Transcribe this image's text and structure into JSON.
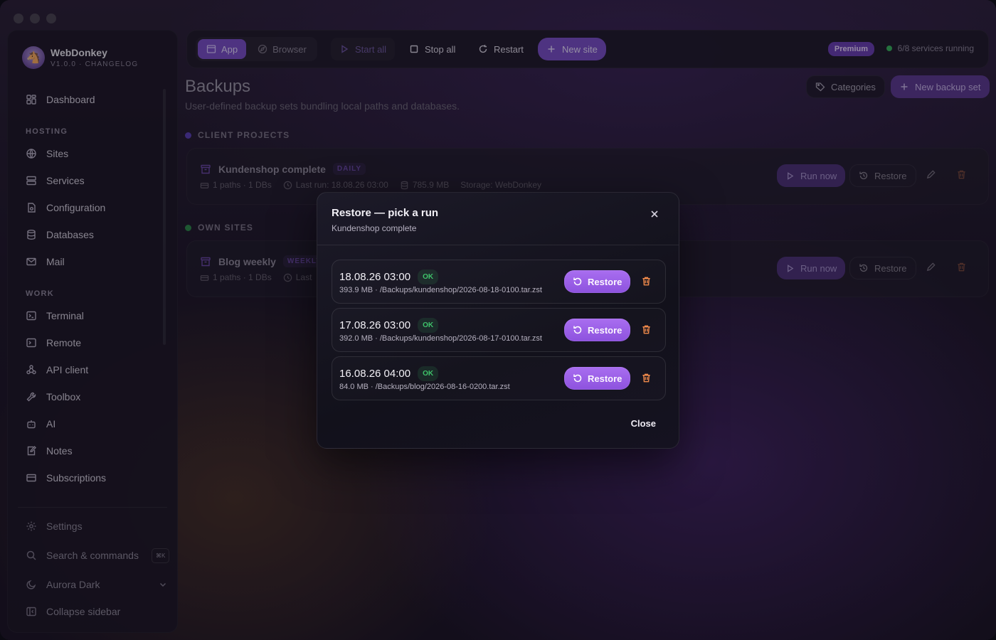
{
  "brand": {
    "name": "WebDonkey",
    "sub": "V1.0.0 · CHANGELOG"
  },
  "sidebar": {
    "top": [
      {
        "label": "Dashboard",
        "icon": "dashboard-icon"
      }
    ],
    "hosting_heading": "HOSTING",
    "hosting": [
      {
        "label": "Sites",
        "icon": "globe-icon"
      },
      {
        "label": "Services",
        "icon": "server-icon"
      },
      {
        "label": "Configuration",
        "icon": "config-file-icon"
      },
      {
        "label": "Databases",
        "icon": "database-icon"
      },
      {
        "label": "Mail",
        "icon": "mail-icon"
      }
    ],
    "work_heading": "WORK",
    "work": [
      {
        "label": "Terminal",
        "icon": "terminal-icon"
      },
      {
        "label": "Remote",
        "icon": "remote-terminal-icon"
      },
      {
        "label": "API client",
        "icon": "webhook-icon"
      },
      {
        "label": "Toolbox",
        "icon": "wrench-icon"
      },
      {
        "label": "AI",
        "icon": "robot-icon"
      },
      {
        "label": "Notes",
        "icon": "notes-icon"
      },
      {
        "label": "Subscriptions",
        "icon": "credit-card-icon"
      }
    ],
    "bottom": {
      "settings": "Settings",
      "search": "Search & commands",
      "search_kbd": "⌘K",
      "theme": "Aurora Dark",
      "collapse": "Collapse sidebar"
    }
  },
  "topbar": {
    "tab_app": "App",
    "tab_browser": "Browser",
    "start_all": "Start all",
    "stop_all": "Stop all",
    "restart": "Restart",
    "new_site": "New site",
    "premium": "Premium",
    "services_status": "6/8 services running"
  },
  "page": {
    "title": "Backups",
    "subtitle": "User-defined backup sets bundling local paths and databases.",
    "categories": "Categories",
    "new_backup_set": "New backup set",
    "groups": [
      {
        "heading": "CLIENT PROJECTS",
        "color": "#5a3fb5",
        "card": {
          "title": "Kundenshop complete",
          "frequency": "DAILY",
          "paths": "1 paths · 1 DBs",
          "last_run": "Last run: 18.08.26 03:00",
          "size": "785.9 MB",
          "storage": "Storage: WebDonkey",
          "run_now": "Run now",
          "restore": "Restore"
        }
      },
      {
        "heading": "OWN SITES",
        "color": "#2c8a4a",
        "card": {
          "title": "Blog weekly",
          "frequency": "WEEKLY",
          "paths": "1 paths · 1 DBs",
          "last_run": "Last",
          "run_now": "Run now",
          "restore": "Restore"
        }
      }
    ]
  },
  "modal": {
    "title": "Restore — pick a run",
    "subtitle": "Kundenshop complete",
    "close_label": "Close",
    "runs": [
      {
        "date": "18.08.26 03:00",
        "status": "OK",
        "meta": "393.9 MB · /Backups/kundenshop/2026-08-18-0100.tar.zst",
        "restore": "Restore"
      },
      {
        "date": "17.08.26 03:00",
        "status": "OK",
        "meta": "392.0 MB · /Backups/kundenshop/2026-08-17-0100.tar.zst",
        "restore": "Restore"
      },
      {
        "date": "16.08.26 04:00",
        "status": "OK",
        "meta": "84.0 MB · /Backups/blog/2026-08-16-0200.tar.zst",
        "restore": "Restore"
      }
    ]
  },
  "colors": {
    "accent": "#8d52de",
    "ok": "#3fc36a",
    "danger": "#f08a4b"
  }
}
